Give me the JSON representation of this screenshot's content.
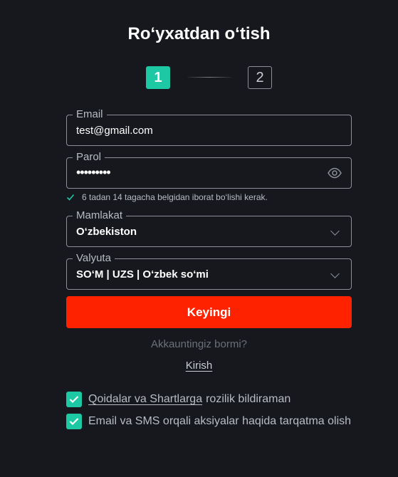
{
  "title": "Ro‘yxatdan o‘tish",
  "steps": [
    "1",
    "2"
  ],
  "fields": {
    "email": {
      "label": "Email",
      "value": "test@gmail.com"
    },
    "password": {
      "label": "Parol",
      "value": "•••••••••"
    },
    "country": {
      "label": "Mamlakat",
      "value": "O‘zbekiston"
    },
    "currency": {
      "label": "Valyuta",
      "value": "SO‘M | UZS | O‘zbek so‘mi"
    }
  },
  "password_hint": "6 tadan 14 tagacha belgidan iborat bo‘lishi kerak.",
  "submit_label": "Keyingi",
  "have_account": "Akkauntingiz bormi?",
  "login_label": "Kirish",
  "checkboxes": {
    "terms_link": "Qoidalar va Shartlarga",
    "terms_text": "rozilik bildiraman",
    "newsletter_text": "Email va SMS orqali aksiyalar haqida tarqatma olish"
  },
  "colors": {
    "background": "#16181d",
    "accent": "#1cc9a4",
    "primary_button": "#ff2200",
    "border": "#8a8f99"
  },
  "icons": {
    "password_toggle": "eye-icon",
    "select_arrow": "chevron-down-icon",
    "hint": "check-icon",
    "checkbox": "checkmark-icon"
  }
}
